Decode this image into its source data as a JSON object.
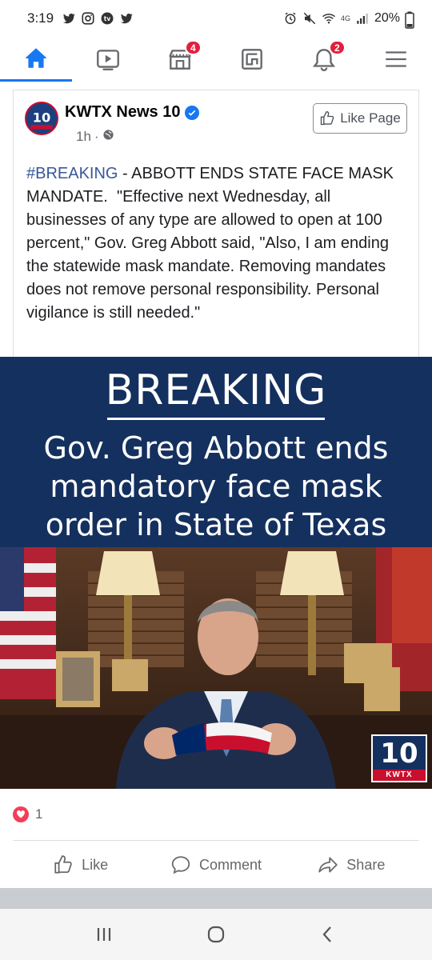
{
  "status_bar": {
    "time": "3:19",
    "network": "4G",
    "battery": "20%",
    "left_icons": [
      "twitter-icon",
      "instagram-icon",
      "tv-app-icon",
      "twitter-icon"
    ],
    "right_icons": [
      "alarm-icon",
      "mute-icon",
      "wifi-icon",
      "signal-icon",
      "battery-icon"
    ]
  },
  "tabs": [
    {
      "name": "home",
      "icon": "home-icon",
      "active": true,
      "badge": ""
    },
    {
      "name": "watch",
      "icon": "video-icon",
      "active": false,
      "badge": ""
    },
    {
      "name": "marketplace",
      "icon": "marketplace-icon",
      "active": false,
      "badge": "4"
    },
    {
      "name": "gaming",
      "icon": "gaming-icon",
      "active": false,
      "badge": ""
    },
    {
      "name": "notifications",
      "icon": "bell-icon",
      "active": false,
      "badge": "2"
    },
    {
      "name": "menu",
      "icon": "menu-icon",
      "active": false,
      "badge": ""
    }
  ],
  "post": {
    "page_name": "KWTX News 10",
    "time": "1h",
    "privacy_icon": "globe-icon",
    "like_page_label": "Like Page",
    "hashtag": "#BREAKING",
    "text": " - ABBOTT ENDS STATE FACE MASK MANDATE.  \"Effective next Wednesday, all businesses of any type are allowed to open at 100 percent,\" Gov. Greg Abbott said, \"Also, I am ending the statewide mask mandate. Removing mandates does not remove personal responsibility. Personal vigilance is still needed.\"",
    "image": {
      "banner_title": "BREAKING",
      "banner_subtitle_lines": [
        "Gov. Greg Abbott ends",
        "mandatory face mask",
        "order in State of Texas"
      ],
      "logo_number": "10",
      "logo_tag": "KWTX"
    },
    "reaction_count": "1",
    "actions": {
      "like": "Like",
      "comment": "Comment",
      "share": "Share"
    }
  },
  "colors": {
    "fb_blue": "#1877f2",
    "banner_navy": "#14305e",
    "badge_red": "#e41e3f"
  }
}
